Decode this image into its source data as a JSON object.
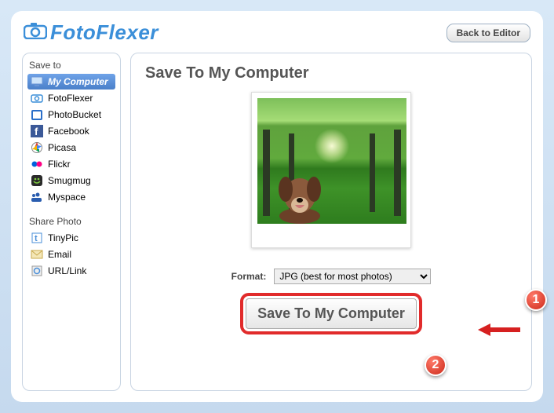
{
  "brand": "FotoFlexer",
  "header": {
    "back_label": "Back to Editor"
  },
  "sidebar": {
    "save_heading": "Save to",
    "save_items": [
      {
        "label": "My Computer",
        "icon": "monitor"
      },
      {
        "label": "FotoFlexer",
        "icon": "camera"
      },
      {
        "label": "PhotoBucket",
        "icon": "bucket"
      },
      {
        "label": "Facebook",
        "icon": "facebook"
      },
      {
        "label": "Picasa",
        "icon": "picasa"
      },
      {
        "label": "Flickr",
        "icon": "flickr"
      },
      {
        "label": "Smugmug",
        "icon": "smugmug"
      },
      {
        "label": "Myspace",
        "icon": "myspace"
      }
    ],
    "share_heading": "Share Photo",
    "share_items": [
      {
        "label": "TinyPic",
        "icon": "tinypic"
      },
      {
        "label": "Email",
        "icon": "email"
      },
      {
        "label": "URL/Link",
        "icon": "link"
      }
    ]
  },
  "main": {
    "title": "Save To My Computer",
    "format_label": "Format:",
    "format_value": "JPG (best for most photos)",
    "save_button": "Save To My Computer"
  },
  "callouts": {
    "one": "1",
    "two": "2"
  }
}
